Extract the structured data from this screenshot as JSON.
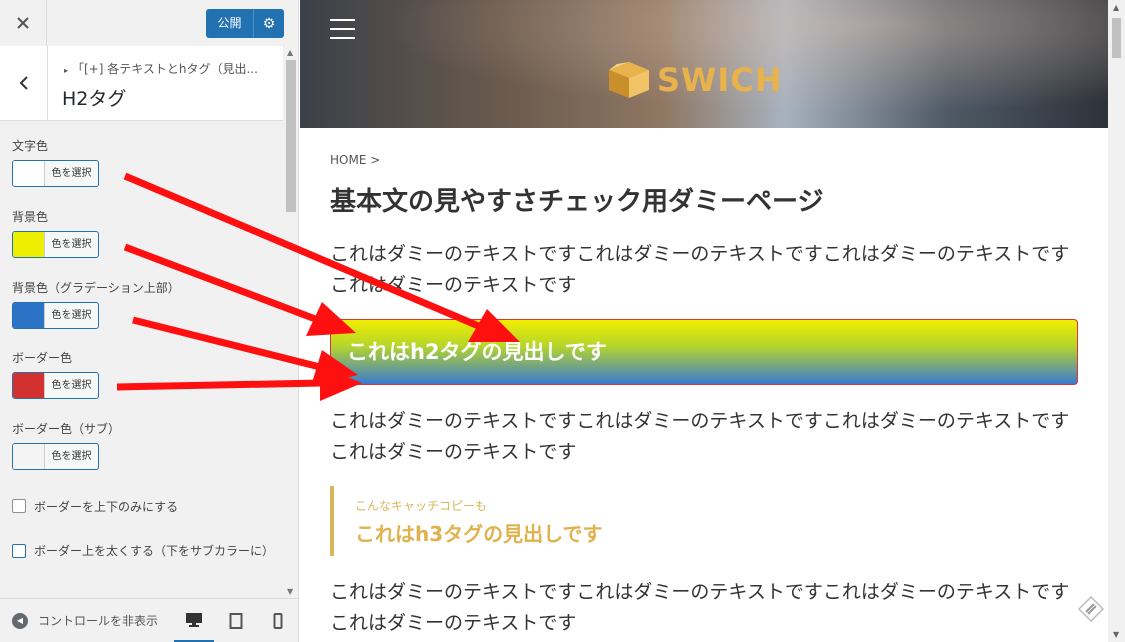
{
  "sidebar": {
    "close_icon": "close-icon",
    "publish_label": "公開",
    "breadcrumb": "「[+] 各テキストとhタグ（見出...",
    "section_title": "H2タグ",
    "controls": [
      {
        "label": "文字色",
        "button": "色を選択",
        "color": "#ffffff"
      },
      {
        "label": "背景色",
        "button": "色を選択",
        "color": "#eeee00"
      },
      {
        "label": "背景色（グラデーション上部）",
        "button": "色を選択",
        "color": "#2d73c5"
      },
      {
        "label": "ボーダー色",
        "button": "色を選択",
        "color": "#d33030"
      },
      {
        "label": "ボーダー色（サブ）",
        "button": "色を選択",
        "color": "#f4f4f4"
      }
    ],
    "checkboxes": [
      {
        "label": "ボーダーを上下のみにする"
      },
      {
        "label": "ボーダー上を太くする（下をサブカラーに）"
      }
    ],
    "footer": {
      "hide_controls": "コントロールを非表示"
    }
  },
  "preview": {
    "logo_text": "SWICH",
    "breadcrumb": "HOME >",
    "page_title": "基本文の見やすさチェック用ダミーページ",
    "para1": "これはダミーのテキストですこれはダミーのテキストですこれはダミーのテキストですこれはダミーのテキストです",
    "h2_text": "これはh2タグの見出しです",
    "para2": "これはダミーのテキストですこれはダミーのテキストですこれはダミーのテキストですこれはダミーのテキストです",
    "catch_copy": "こんなキャッチコピーも",
    "h3_text": "これはh3タグの見出しです",
    "para3": "これはダミーのテキストですこれはダミーのテキストですこれはダミーのテキストですこれはダミーのテキストです"
  },
  "colors": {
    "accent": "#2271b1",
    "arrow": "#ff0000",
    "h3_gold": "#d9b65a"
  }
}
